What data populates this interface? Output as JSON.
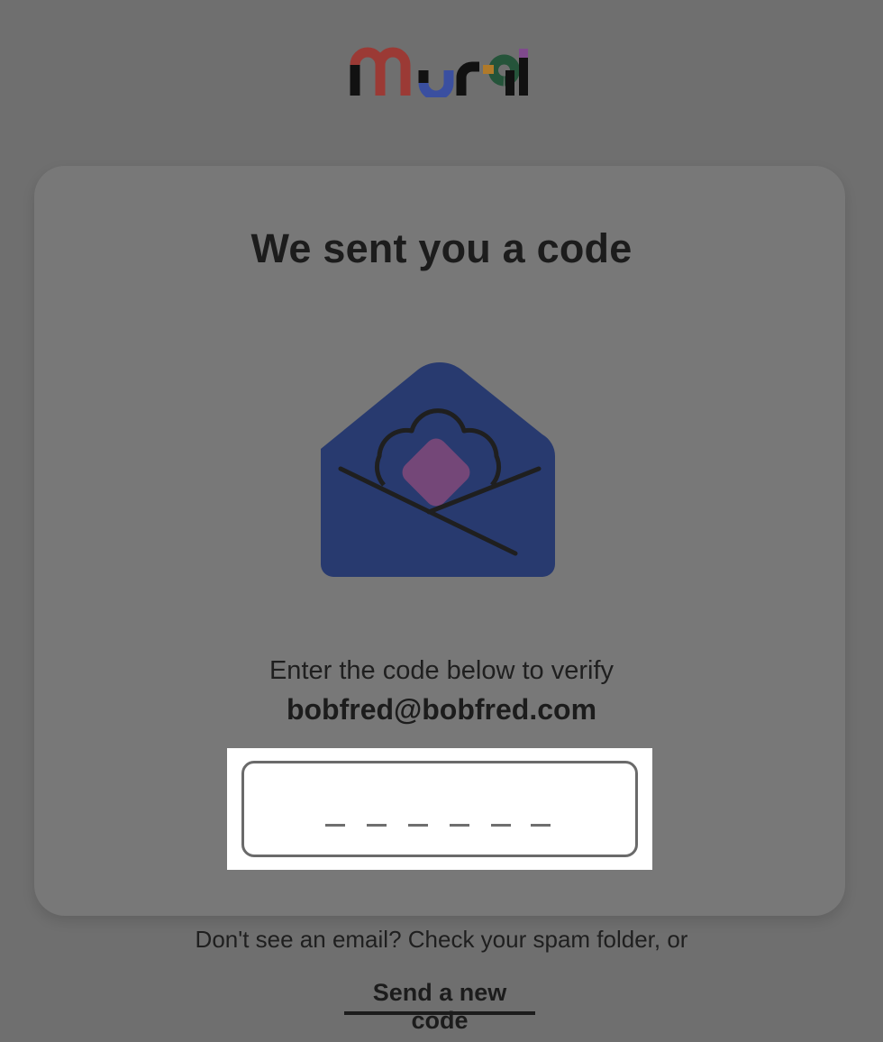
{
  "brand": {
    "logo_text": "Mural",
    "colors": {
      "m": "#9b3a35",
      "u": "#3a4fa0",
      "r": "#111111",
      "a": "#25543a",
      "l": "#7f4a8c",
      "accent_dot": "#b07a2a"
    }
  },
  "verify": {
    "title": "We sent you a code",
    "illustration": "open-envelope-icon",
    "instruction": "Enter the code below to verify",
    "email": "bobfred@bobfred.com",
    "code_length": 6,
    "code_value": ""
  },
  "footer": {
    "spam_text": "Don't see an email? Check your spam folder, or",
    "resend_label": "Send a new code"
  },
  "colors": {
    "overlay_bg": "#6f6f6f",
    "card_bg": "#787878",
    "envelope": "#283a6f",
    "diamond": "#744778",
    "input_bg": "#ffffff"
  }
}
